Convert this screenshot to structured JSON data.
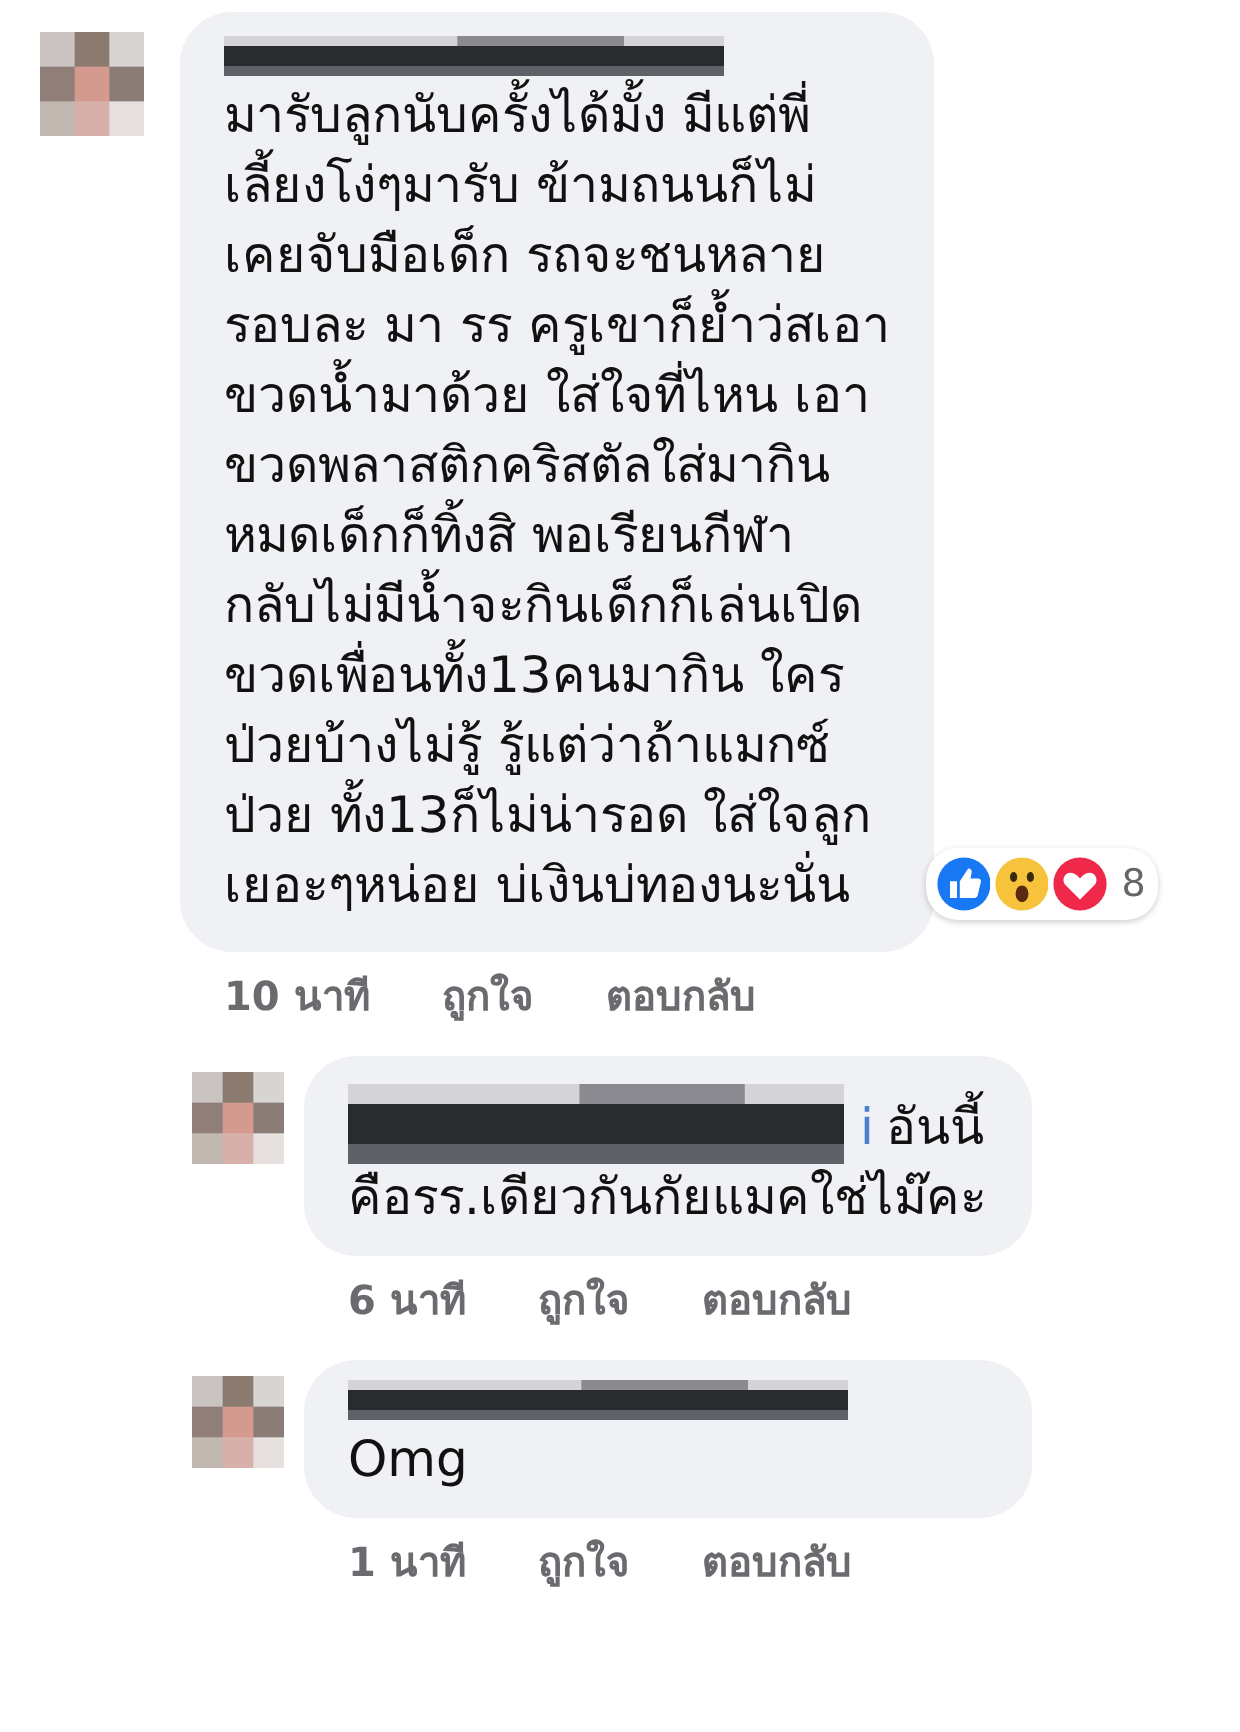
{
  "comments": [
    {
      "kind": "post",
      "body": {
        "lines": [
          "มารับลูกนับครั้งได้มั้ง มีแต่พี่",
          "เลี้ยงโง่ๆมารับ ข้ามถนนก็ไม่",
          "เคยจับมือเด็ก รถจะชนหลาย",
          "รอบละ มา รร ครูเขาก็ย้ำว่สเอา",
          "ขวดน้ำมาด้วย ใส่ใจที่ไหน เอา",
          "ขวดพลาสติกคริสตัลใส่มากิน",
          "หมดเด็กก็ทิ้งสิ พอเรียนกีฬา",
          "กลับไม่มีน้ำจะกินเด็กก็เล่นเปิด",
          "ขวดเพื่อนทั้ง13คนมากิน ใคร",
          "ป่วยบ้างไม่รู้ รู้แต่ว่าถ้าแมกซ์",
          "ป่วย ทั้ง13ก็ไม่น่ารอด ใส่ใจลูก",
          "เยอะๆหน่อย บ่เงินบ่ทองนะนั่น"
        ]
      },
      "reactions": {
        "icons": [
          {
            "kind": "like"
          },
          {
            "kind": "wow"
          },
          {
            "kind": "love"
          }
        ],
        "count": "8"
      },
      "actions": {
        "time": "10 นาที",
        "like": "ถูกใจ",
        "reply": "ตอบกลับ"
      }
    },
    {
      "kind": "reply",
      "body": {
        "mention_tail": "i",
        "lines": [
          "อันนี้",
          "คือรร.เดียวกันกัยแมคใช่ไม๊คะ"
        ]
      },
      "actions": {
        "time": "6 นาที",
        "like": "ถูกใจ",
        "reply": "ตอบกลับ"
      }
    },
    {
      "kind": "reply",
      "body": {
        "lines": [
          "Omg"
        ]
      },
      "actions": {
        "time": "1 นาที",
        "like": "ถูกใจ",
        "reply": "ตอบกลับ"
      }
    }
  ]
}
